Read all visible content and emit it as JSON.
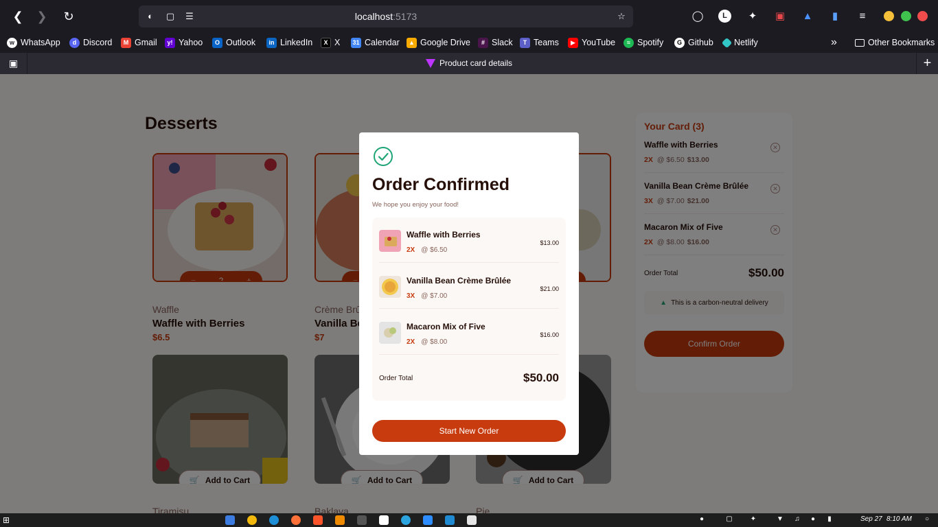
{
  "browser": {
    "url_host": "localhost",
    "url_port": ":5173",
    "account_initial": "L",
    "tab_title": "Product card details",
    "bookmarks": [
      "WhatsApp",
      "Discord",
      "Gmail",
      "Yahoo",
      "Outlook",
      "LinkedIn",
      "X",
      "Calendar",
      "Google Drive",
      "Slack",
      "Teams",
      "YouTube",
      "Spotify",
      "Github",
      "Netlify"
    ],
    "other_bookmarks": "Other Bookmarks"
  },
  "page": {
    "title": "Desserts",
    "products": [
      {
        "category": "Waffle",
        "name": "Waffle with Berries",
        "price": "$6.5",
        "qty": "2"
      },
      {
        "category": "Crème Brûlée",
        "name": "Vanilla Bean Crème Brûlée",
        "price": "$7"
      },
      {
        "category": "Tiramisu",
        "add_label": "Add to Cart"
      },
      {
        "category": "Baklava",
        "add_label": "Add to Cart"
      },
      {
        "category": "Pie",
        "add_label": "Add to Cart"
      }
    ]
  },
  "cart": {
    "title": "Your Card (3)",
    "items": [
      {
        "name": "Waffle with Berries",
        "qty": "2X",
        "unit": "@ $6.50",
        "total": "$13.00"
      },
      {
        "name": "Vanilla Bean Crème Brûlée",
        "qty": "3X",
        "unit": "@ $7.00",
        "total": "$21.00"
      },
      {
        "name": "Macaron Mix of Five",
        "qty": "2X",
        "unit": "@ $8.00",
        "total": "$16.00"
      }
    ],
    "total_label": "Order Total",
    "total_value": "$50.00",
    "carbon_note": "This is a carbon-neutral delivery",
    "confirm_label": "Confirm Order"
  },
  "modal": {
    "title": "Order Confirmed",
    "subtitle": "We hope you enjoy your food!",
    "items": [
      {
        "name": "Waffle with Berries",
        "qty": "2X",
        "unit": "@ $6.50",
        "total": "$13.00"
      },
      {
        "name": "Vanilla Bean Crème Brûlée",
        "qty": "3X",
        "unit": "@ $7.00",
        "total": "$21.00"
      },
      {
        "name": "Macaron Mix of Five",
        "qty": "2X",
        "unit": "@ $8.00",
        "total": "$16.00"
      }
    ],
    "total_label": "Order Total",
    "total_value": "$50.00",
    "button_label": "Start New Order"
  },
  "taskbar": {
    "date": "Sep 27",
    "time": "8:10 AM"
  },
  "colors": {
    "accent": "#c73b0f",
    "success": "#1ea575",
    "overlay": "rgba(0,0,0,0.5)"
  }
}
